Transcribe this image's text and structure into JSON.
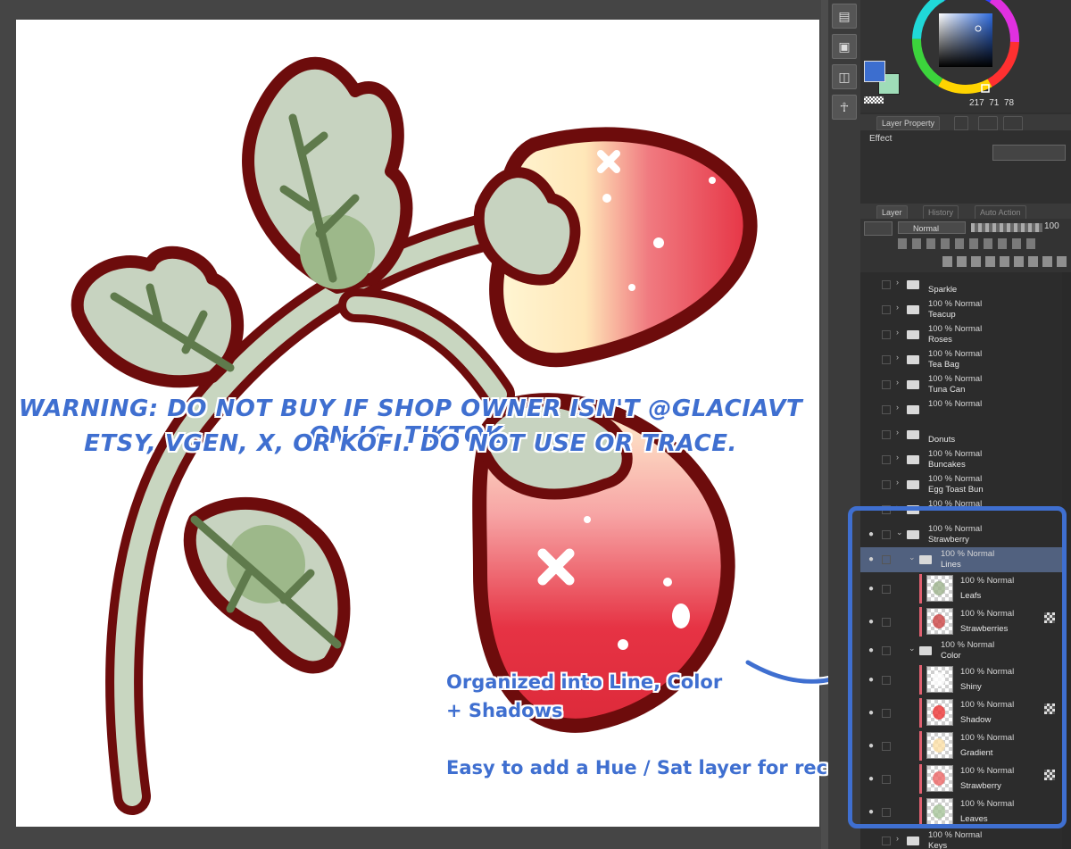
{
  "watermark": {
    "line1": "WARNING: DO NOT BUY IF SHOP OWNER ISN'T @GLACIAVT ON IG, TIKTOK,",
    "line2": "ETSY, VGEN, X, OR KOFI. DO NOT USE OR TRACE."
  },
  "annotation": {
    "line1": "Organized into Line, Color",
    "line2": "+ Shadows",
    "line3": "Easy to add a Hue / Sat layer for recolors!"
  },
  "colors": {
    "main_color": "#3c6ecf",
    "sub_color": "#9fdcb8",
    "accent": "#3f6fd0"
  },
  "color_values": {
    "h": "217",
    "s": "71",
    "v": "78"
  },
  "panels": {
    "property_tab": "Layer Property",
    "effect_label": "Effect",
    "layer_tab": "Layer",
    "history_tab": "History",
    "auto_action_tab": "Auto Action",
    "blend_mode": "Normal",
    "opacity": "100"
  },
  "layers": [
    {
      "kind": "folder",
      "top": "",
      "name": "Sparkle"
    },
    {
      "kind": "folder",
      "top": "100 % Normal",
      "name": "Teacup"
    },
    {
      "kind": "folder",
      "top": "100 % Normal",
      "name": "Roses"
    },
    {
      "kind": "folder",
      "top": "100 % Normal",
      "name": "Tea Bag"
    },
    {
      "kind": "folder",
      "top": "100 % Normal",
      "name": "Tuna Can"
    },
    {
      "kind": "folder",
      "top": "100 % Normal",
      "name": ""
    },
    {
      "kind": "folder",
      "top": "",
      "name": "Donuts"
    },
    {
      "kind": "folder",
      "top": "100 % Normal",
      "name": "Buncakes"
    },
    {
      "kind": "folder",
      "top": "100 % Normal",
      "name": "Egg Toast Bun"
    },
    {
      "kind": "folder",
      "top": "100 % Normal",
      "name": ""
    },
    {
      "kind": "folder-open",
      "top": "100 % Normal",
      "name": "Strawberry"
    },
    {
      "kind": "subfolder-open",
      "top": "100 % Normal",
      "name": "Lines"
    },
    {
      "kind": "layer",
      "top": "100 % Normal",
      "name": "Leafs"
    },
    {
      "kind": "layer",
      "top": "100 % Normal",
      "name": "Strawberries"
    },
    {
      "kind": "subfolder-open",
      "top": "100 % Normal",
      "name": "Color"
    },
    {
      "kind": "layer",
      "top": "100 % Normal",
      "name": "Shiny"
    },
    {
      "kind": "layer",
      "top": "100 % Normal",
      "name": "Shadow"
    },
    {
      "kind": "layer",
      "top": "100 % Normal",
      "name": "Gradient"
    },
    {
      "kind": "layer",
      "top": "100 % Normal",
      "name": "Strawberry"
    },
    {
      "kind": "layer",
      "top": "100 % Normal",
      "name": "Leaves"
    },
    {
      "kind": "folder",
      "top": "100 % Normal",
      "name": "Keys"
    }
  ]
}
